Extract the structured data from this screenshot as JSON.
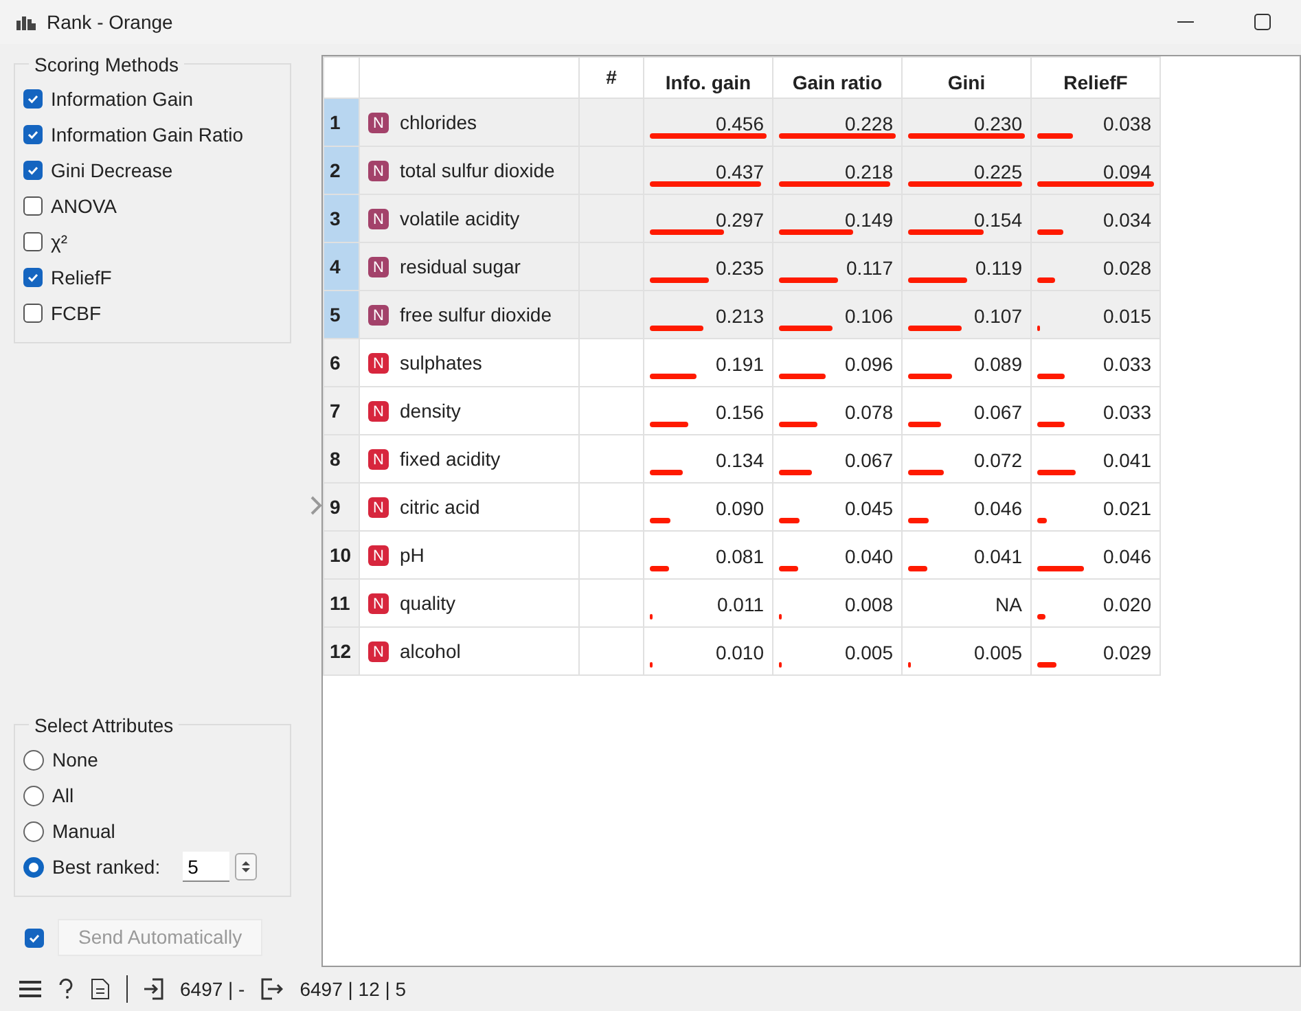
{
  "window": {
    "title": "Rank - Orange"
  },
  "scoring_methods": {
    "title": "Scoring Methods",
    "items": [
      {
        "label": "Information Gain",
        "checked": true
      },
      {
        "label": "Information Gain Ratio",
        "checked": true
      },
      {
        "label": "Gini Decrease",
        "checked": true
      },
      {
        "label": "ANOVA",
        "checked": false
      },
      {
        "label": "χ²",
        "checked": false
      },
      {
        "label": "ReliefF",
        "checked": true
      },
      {
        "label": "FCBF",
        "checked": false
      }
    ]
  },
  "select_attributes": {
    "title": "Select Attributes",
    "options": [
      {
        "label": "None",
        "selected": false
      },
      {
        "label": "All",
        "selected": false
      },
      {
        "label": "Manual",
        "selected": false
      },
      {
        "label": "Best ranked:",
        "selected": true
      }
    ],
    "best_ranked_value": "5"
  },
  "send_automatically": {
    "label": "Send Automatically",
    "checked": true
  },
  "table": {
    "columns": [
      "#",
      "Info. gain",
      "Gain ratio",
      "Gini",
      "ReliefF"
    ],
    "rows": [
      {
        "index": "1",
        "type_badge": "N",
        "name": "chlorides",
        "selected": true,
        "scores": [
          {
            "text": "0.456",
            "level": 1.0
          },
          {
            "text": "0.228",
            "level": 1.0
          },
          {
            "text": "0.230",
            "level": 1.0
          },
          {
            "text": "0.038",
            "level": 0.3
          }
        ]
      },
      {
        "index": "2",
        "type_badge": "N",
        "name": "total sulfur dioxide",
        "selected": true,
        "scores": [
          {
            "text": "0.437",
            "level": 0.95
          },
          {
            "text": "0.218",
            "level": 0.95
          },
          {
            "text": "0.225",
            "level": 0.98
          },
          {
            "text": "0.094",
            "level": 1.0
          }
        ]
      },
      {
        "index": "3",
        "type_badge": "N",
        "name": "volatile acidity",
        "selected": true,
        "scores": [
          {
            "text": "0.297",
            "level": 0.63
          },
          {
            "text": "0.149",
            "level": 0.63
          },
          {
            "text": "0.154",
            "level": 0.65
          },
          {
            "text": "0.034",
            "level": 0.22
          }
        ]
      },
      {
        "index": "4",
        "type_badge": "N",
        "name": "residual sugar",
        "selected": true,
        "scores": [
          {
            "text": "0.235",
            "level": 0.5
          },
          {
            "text": "0.117",
            "level": 0.5
          },
          {
            "text": "0.119",
            "level": 0.5
          },
          {
            "text": "0.028",
            "level": 0.15
          }
        ]
      },
      {
        "index": "5",
        "type_badge": "N",
        "name": "free sulfur dioxide",
        "selected": true,
        "scores": [
          {
            "text": "0.213",
            "level": 0.46
          },
          {
            "text": "0.106",
            "level": 0.46
          },
          {
            "text": "0.107",
            "level": 0.46
          },
          {
            "text": "0.015",
            "level": 0.02
          }
        ]
      },
      {
        "index": "6",
        "type_badge": "N",
        "name": "sulphates",
        "selected": false,
        "scores": [
          {
            "text": "0.191",
            "level": 0.4
          },
          {
            "text": "0.096",
            "level": 0.4
          },
          {
            "text": "0.089",
            "level": 0.38
          },
          {
            "text": "0.033",
            "level": 0.24
          }
        ]
      },
      {
        "index": "7",
        "type_badge": "N",
        "name": "density",
        "selected": false,
        "scores": [
          {
            "text": "0.156",
            "level": 0.33
          },
          {
            "text": "0.078",
            "level": 0.33
          },
          {
            "text": "0.067",
            "level": 0.28
          },
          {
            "text": "0.033",
            "level": 0.24
          }
        ]
      },
      {
        "index": "8",
        "type_badge": "N",
        "name": "fixed acidity",
        "selected": false,
        "scores": [
          {
            "text": "0.134",
            "level": 0.28
          },
          {
            "text": "0.067",
            "level": 0.28
          },
          {
            "text": "0.072",
            "level": 0.3
          },
          {
            "text": "0.041",
            "level": 0.33
          }
        ]
      },
      {
        "index": "9",
        "type_badge": "N",
        "name": "citric acid",
        "selected": false,
        "scores": [
          {
            "text": "0.090",
            "level": 0.18
          },
          {
            "text": "0.045",
            "level": 0.18
          },
          {
            "text": "0.046",
            "level": 0.18
          },
          {
            "text": "0.021",
            "level": 0.08
          }
        ]
      },
      {
        "index": "10",
        "type_badge": "N",
        "name": "pH",
        "selected": false,
        "scores": [
          {
            "text": "0.081",
            "level": 0.17
          },
          {
            "text": "0.040",
            "level": 0.17
          },
          {
            "text": "0.041",
            "level": 0.17
          },
          {
            "text": "0.046",
            "level": 0.4
          }
        ]
      },
      {
        "index": "11",
        "type_badge": "N",
        "name": "quality",
        "selected": false,
        "scores": [
          {
            "text": "0.011",
            "level": 0.01
          },
          {
            "text": "0.008",
            "level": 0.01
          },
          {
            "text": "NA"
          },
          {
            "text": "0.020",
            "level": 0.07
          }
        ]
      },
      {
        "index": "12",
        "type_badge": "N",
        "name": "alcohol",
        "selected": false,
        "scores": [
          {
            "text": "0.010",
            "level": 0.01
          },
          {
            "text": "0.005",
            "level": 0.01
          },
          {
            "text": "0.005",
            "level": 0.01
          },
          {
            "text": "0.029",
            "level": 0.17
          }
        ]
      }
    ]
  },
  "status_bar": {
    "input": "6497 | -",
    "output": "6497 | 12 | 5"
  }
}
